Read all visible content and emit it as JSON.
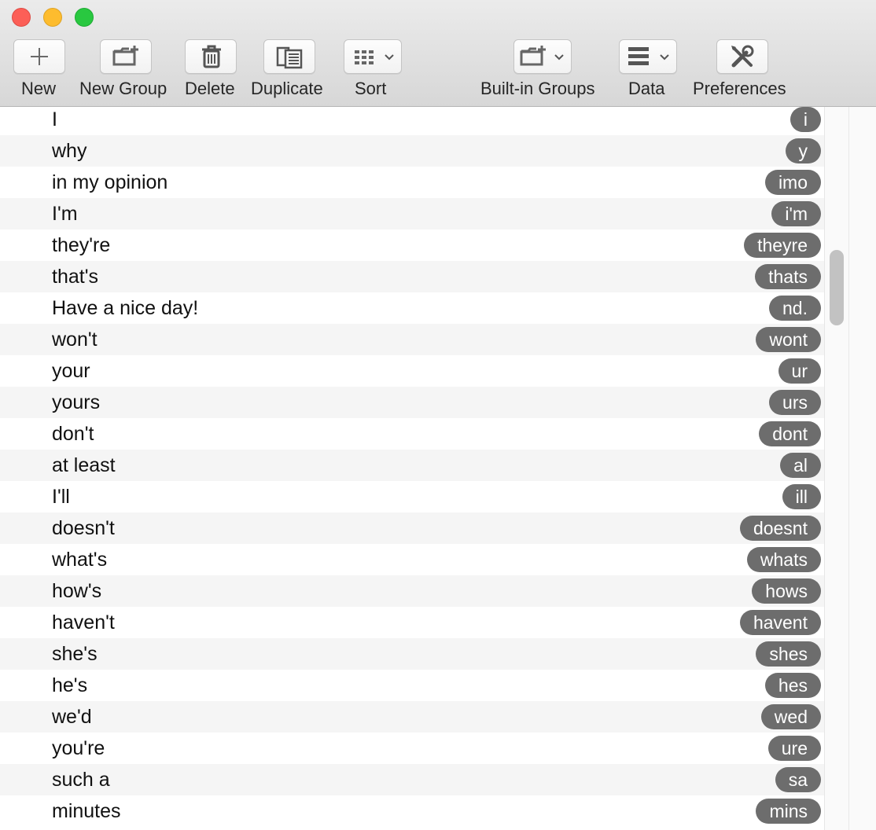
{
  "window": {
    "controls": [
      "close-icon",
      "minimize-icon",
      "zoom-icon"
    ]
  },
  "toolbar": {
    "new_label": "New",
    "new_group_label": "New Group",
    "delete_label": "Delete",
    "duplicate_label": "Duplicate",
    "sort_label": "Sort",
    "builtin_groups_label": "Built-in Groups",
    "data_label": "Data",
    "preferences_label": "Preferences",
    "icons": {
      "new": "plus-icon",
      "new_group": "folder-plus-icon",
      "delete": "trash-icon",
      "duplicate": "duplicate-icon",
      "sort": "grid-icon",
      "builtin_groups": "folder-plus-icon",
      "data": "list-icon",
      "preferences": "wrench-screwdriver-icon"
    }
  },
  "colors": {
    "badge": "#6d6d6d",
    "row_alt": "#f5f5f5",
    "close": "#fc5f57",
    "minimize": "#fdbc2e",
    "zoom": "#29c840"
  },
  "rows": [
    {
      "phrase": "I",
      "abbr": "i"
    },
    {
      "phrase": "why",
      "abbr": "y"
    },
    {
      "phrase": "in my opinion",
      "abbr": "imo"
    },
    {
      "phrase": "I'm",
      "abbr": "i'm"
    },
    {
      "phrase": "they're",
      "abbr": "theyre"
    },
    {
      "phrase": "that's",
      "abbr": "thats"
    },
    {
      "phrase": "Have a nice day!",
      "abbr": "nd."
    },
    {
      "phrase": "won't",
      "abbr": "wont"
    },
    {
      "phrase": "your",
      "abbr": "ur"
    },
    {
      "phrase": "yours",
      "abbr": "urs"
    },
    {
      "phrase": "don't",
      "abbr": "dont"
    },
    {
      "phrase": "at least",
      "abbr": "al"
    },
    {
      "phrase": "I'll",
      "abbr": "ill"
    },
    {
      "phrase": "doesn't",
      "abbr": "doesnt"
    },
    {
      "phrase": "what's",
      "abbr": "whats"
    },
    {
      "phrase": "how's",
      "abbr": "hows"
    },
    {
      "phrase": "haven't",
      "abbr": "havent"
    },
    {
      "phrase": "she's",
      "abbr": "shes"
    },
    {
      "phrase": "he's",
      "abbr": "hes"
    },
    {
      "phrase": "we'd",
      "abbr": "wed"
    },
    {
      "phrase": "you're",
      "abbr": "ure"
    },
    {
      "phrase": "such a",
      "abbr": "sa"
    },
    {
      "phrase": "minutes",
      "abbr": "mins"
    }
  ]
}
